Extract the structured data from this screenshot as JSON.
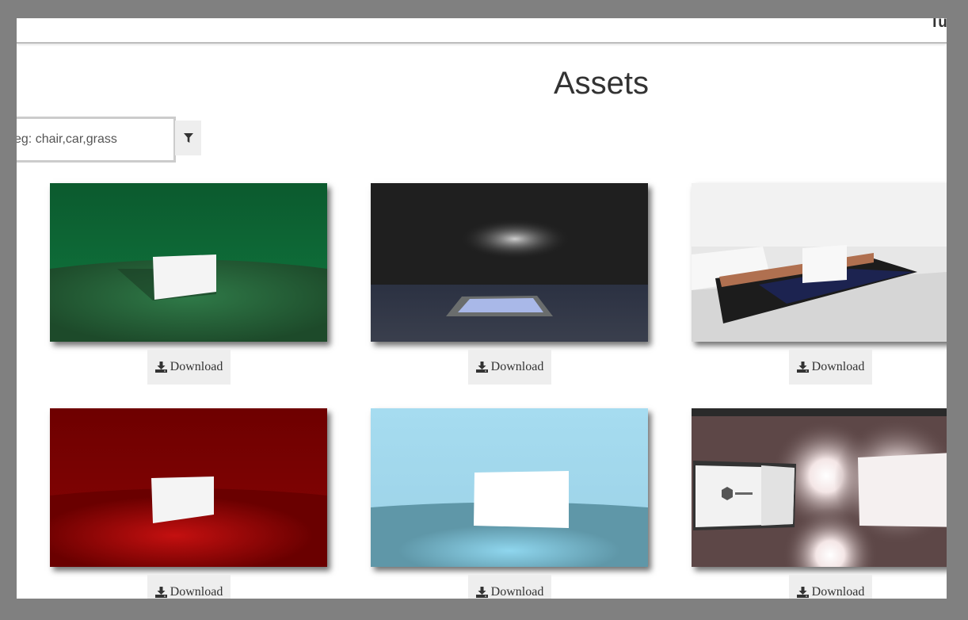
{
  "header": {
    "corner_text": "Tu"
  },
  "page": {
    "title": "Assets"
  },
  "search": {
    "placeholder": "eg: chair,car,grass",
    "value": ""
  },
  "filter_button": {
    "icon": "filter-icon"
  },
  "assets": [
    {
      "download_label": "Download",
      "icon": "download-icon"
    },
    {
      "download_label": "Download",
      "icon": "download-icon"
    },
    {
      "download_label": "Download",
      "icon": "download-icon"
    },
    {
      "download_label": "Download",
      "icon": "download-icon"
    },
    {
      "download_label": "Download",
      "icon": "download-icon"
    },
    {
      "download_label": "Download",
      "icon": "download-icon"
    }
  ],
  "colors": {
    "background": "#808080",
    "button_bg": "#eeeeee",
    "text": "#333333"
  }
}
